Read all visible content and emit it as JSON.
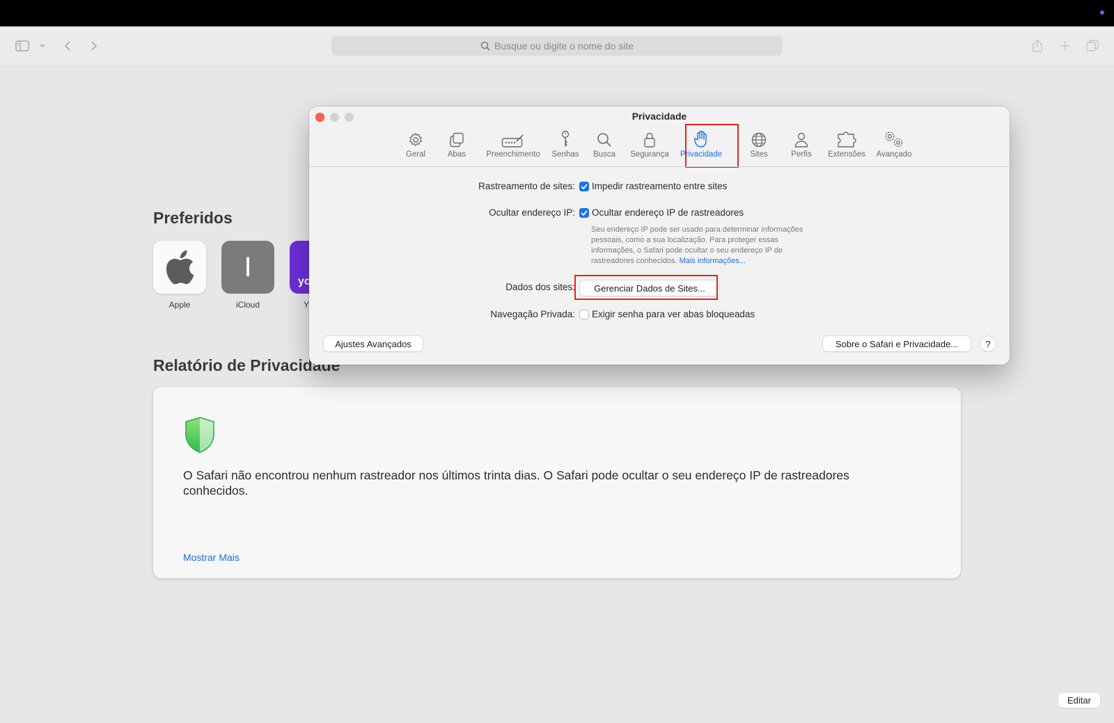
{
  "browser": {
    "address_placeholder": "Busque ou digite o nome do site",
    "icons": [
      "sidebar-icon",
      "chevron-down-icon",
      "back-icon",
      "forward-icon",
      "share-icon",
      "new-tab-icon",
      "tab-overview-icon"
    ]
  },
  "start_page": {
    "favorites_title": "Preferidos",
    "favorites": [
      {
        "label": "Apple",
        "icon": "apple-logo"
      },
      {
        "label": "iCloud",
        "glyph": "I"
      },
      {
        "label": "Y",
        "glyph": "yo"
      }
    ],
    "report_title": "Relatório de Privacidade",
    "report_message": "O Safari não encontrou nenhum rastreador nos últimos trinta dias. O Safari pode ocultar o seu endereço IP de rastreadores conhecidos.",
    "show_more": "Mostrar Mais",
    "edit_button": "Editar"
  },
  "dialog": {
    "title": "Privacidade",
    "tabs": [
      {
        "label": "Geral",
        "icon": "gear-icon"
      },
      {
        "label": "Abas",
        "icon": "tabs-icon"
      },
      {
        "label": "Preenchimento",
        "icon": "autofill-icon"
      },
      {
        "label": "Senhas",
        "icon": "key-icon"
      },
      {
        "label": "Busca",
        "icon": "search-icon"
      },
      {
        "label": "Segurança",
        "icon": "lock-icon"
      },
      {
        "label": "Privacidade",
        "icon": "hand-icon",
        "selected": true
      },
      {
        "label": "Sites",
        "icon": "globe-icon"
      },
      {
        "label": "Perfis",
        "icon": "person-icon"
      },
      {
        "label": "Extensões",
        "icon": "puzzle-icon"
      },
      {
        "label": "Avançado",
        "icon": "gears-icon"
      }
    ],
    "tracking_label": "Rastreamento de sites:",
    "tracking_option": "Impedir rastreamento entre sites",
    "tracking_checked": true,
    "hide_ip_label": "Ocultar endereço IP:",
    "hide_ip_option": "Ocultar endereço IP de rastreadores",
    "hide_ip_checked": true,
    "hide_ip_description_lines": [
      "Seu endereço IP pode ser usado para determinar informações",
      "pessoais, como a sua localização. Para proteger essas",
      "informações, o Safari pode ocultar o seu endereço IP de",
      "rastreadores conhecidos."
    ],
    "more_info_link": "Mais informações...",
    "site_data_label": "Dados dos sites:",
    "manage_button": "Gerenciar Dados de Sites...",
    "private_label": "Navegação Privada:",
    "private_option": "Exigir senha para ver abas bloqueadas",
    "private_checked": false,
    "advanced_button": "Ajustes Avançados",
    "about_button": "Sobre o Safari e Privacidade...",
    "help_button": "?"
  },
  "colors": {
    "accent": "#1a6fe0",
    "highlight": "#e0241c",
    "close": "#ff5f57"
  }
}
